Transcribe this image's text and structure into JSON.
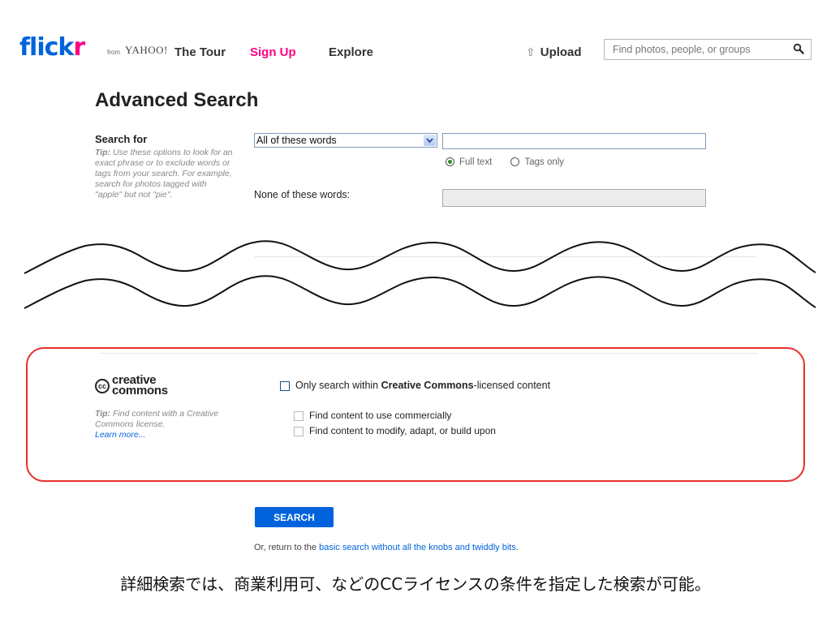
{
  "header": {
    "logo": {
      "part1": "flick",
      "part2": "r",
      "from": "from",
      "yahoo": "YAHOO!"
    },
    "nav": {
      "tour": "The Tour",
      "signup": "Sign Up",
      "explore": "Explore"
    },
    "upload": "Upload",
    "search_placeholder": "Find photos, people, or groups"
  },
  "advanced": {
    "title": "Advanced Search",
    "search_for_label": "Search for",
    "tip_prefix": "Tip:",
    "tip_text": " Use these options to look for an exact phrase or to exclude words or tags from your search. For example, search for photos tagged with \"apple\" but not \"pie\".",
    "select_value": "All of these words",
    "radio_full_text": "Full text",
    "radio_tags_only": "Tags only",
    "none_label": "None of these words:"
  },
  "cc": {
    "logo_line1": "creative",
    "logo_line2": "commons",
    "logo_badge": "cc",
    "tip_prefix": "Tip:",
    "tip_text": " Find content with a Creative Commons license.",
    "learn_more": "Learn more...",
    "main_pre": "Only search within ",
    "main_bold": "Creative Commons",
    "main_post": "-licensed content",
    "opt_commercial": "Find content to use commercially",
    "opt_modify": "Find content to modify, adapt, or build upon"
  },
  "footer": {
    "search_button": "SEARCH",
    "return_pre": "Or, return to the ",
    "return_link": "basic search without all the knobs and twiddly bits",
    "return_post": "."
  },
  "caption": "詳細検索では、商業利用可、などのCCライセンスの条件を指定した検索が可能。",
  "colors": {
    "flickr_blue": "#0063dc",
    "flickr_pink": "#ff0084",
    "highlight_red": "#e5302a"
  }
}
